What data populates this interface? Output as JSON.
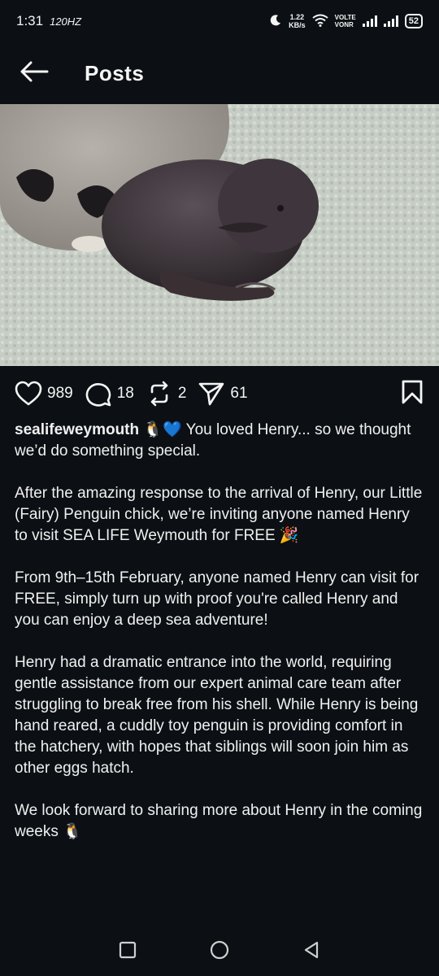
{
  "status_bar": {
    "time": "1:31",
    "refresh_rate": "120HZ",
    "speed_value": "1.22",
    "speed_unit": "KB/s",
    "volte_top": "VOLTE",
    "volte_bottom": "VONR",
    "battery": "52"
  },
  "header": {
    "title": "Posts"
  },
  "post": {
    "likes": "989",
    "comments": "18",
    "reposts": "2",
    "shares": "61",
    "username": "sealifeweymouth",
    "caption_intro": " 🐧💙 You loved Henry... so we thought we’d do something special.",
    "paragraphs": [
      "After the amazing response to the arrival of Henry, our Little (Fairy) Penguin chick, we’re inviting anyone named Henry to visit SEA LIFE Weymouth for FREE 🎉",
      "From 9th–15th February, anyone named Henry can visit for FREE, simply turn up with proof you're called Henry and you can enjoy a deep sea adventure!",
      "Henry had a dramatic entrance into the world, requiring gentle assistance from our expert animal care team after struggling to break free from his shell. While Henry is being hand reared, a cuddly toy penguin is providing comfort in the hatchery, with hopes that siblings will soon join him as other eggs hatch.",
      "We look forward to sharing more about Henry in the coming weeks 🐧"
    ]
  },
  "colors": {
    "background": "#0c1014",
    "text": "#f5f5f5"
  },
  "icons": {
    "back": "arrow-left-icon",
    "like": "heart-icon",
    "comment": "comment-bubble-icon",
    "repost": "repost-icon",
    "share": "send-icon",
    "save": "bookmark-icon"
  }
}
